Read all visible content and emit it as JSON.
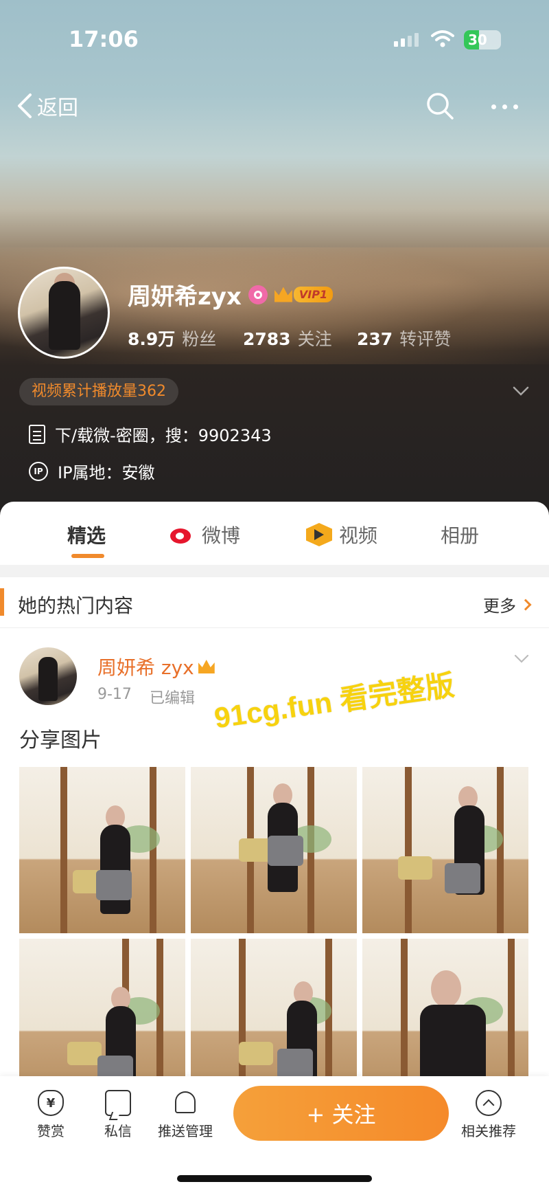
{
  "status_bar": {
    "time": "17:06",
    "battery": "30"
  },
  "nav": {
    "back_label": "返回"
  },
  "profile": {
    "name": "周妍希zyx",
    "vip_label": "VIP1",
    "stats": [
      {
        "value": "8.9万",
        "label": "粉丝"
      },
      {
        "value": "2783",
        "label": "关注"
      },
      {
        "value": "237",
        "label": "转评赞"
      }
    ],
    "video_plays": "视频累计播放量362",
    "bio": "下/载微-密圈，搜：9902343",
    "ip_location": "IP属地：安徽",
    "ip_icon_text": "IP"
  },
  "tabs": [
    {
      "label": "精选",
      "active": true
    },
    {
      "label": "微博",
      "icon": "weibo-icon"
    },
    {
      "label": "视频",
      "icon": "video-icon"
    },
    {
      "label": "相册"
    }
  ],
  "hot_section": {
    "title": "她的热门内容",
    "more_label": "更多"
  },
  "post": {
    "author": "周妍希 zyx",
    "date": "9-17",
    "edited": "已编辑",
    "text": "分享图片",
    "watermark": "91cg.fun 看完整版",
    "photo_count": 6
  },
  "bottom_bar": {
    "items": [
      {
        "label": "赞赏",
        "icon": "yen-icon"
      },
      {
        "label": "私信",
        "icon": "chat-icon"
      },
      {
        "label": "推送管理",
        "icon": "bell-icon"
      },
      {
        "label": "相关推荐",
        "icon": "up-circle-icon"
      }
    ],
    "follow_label": "+ 关注"
  },
  "colors": {
    "accent": "#f08a2c",
    "name_orange": "#e8702a",
    "follow_button": "#f5962f"
  }
}
